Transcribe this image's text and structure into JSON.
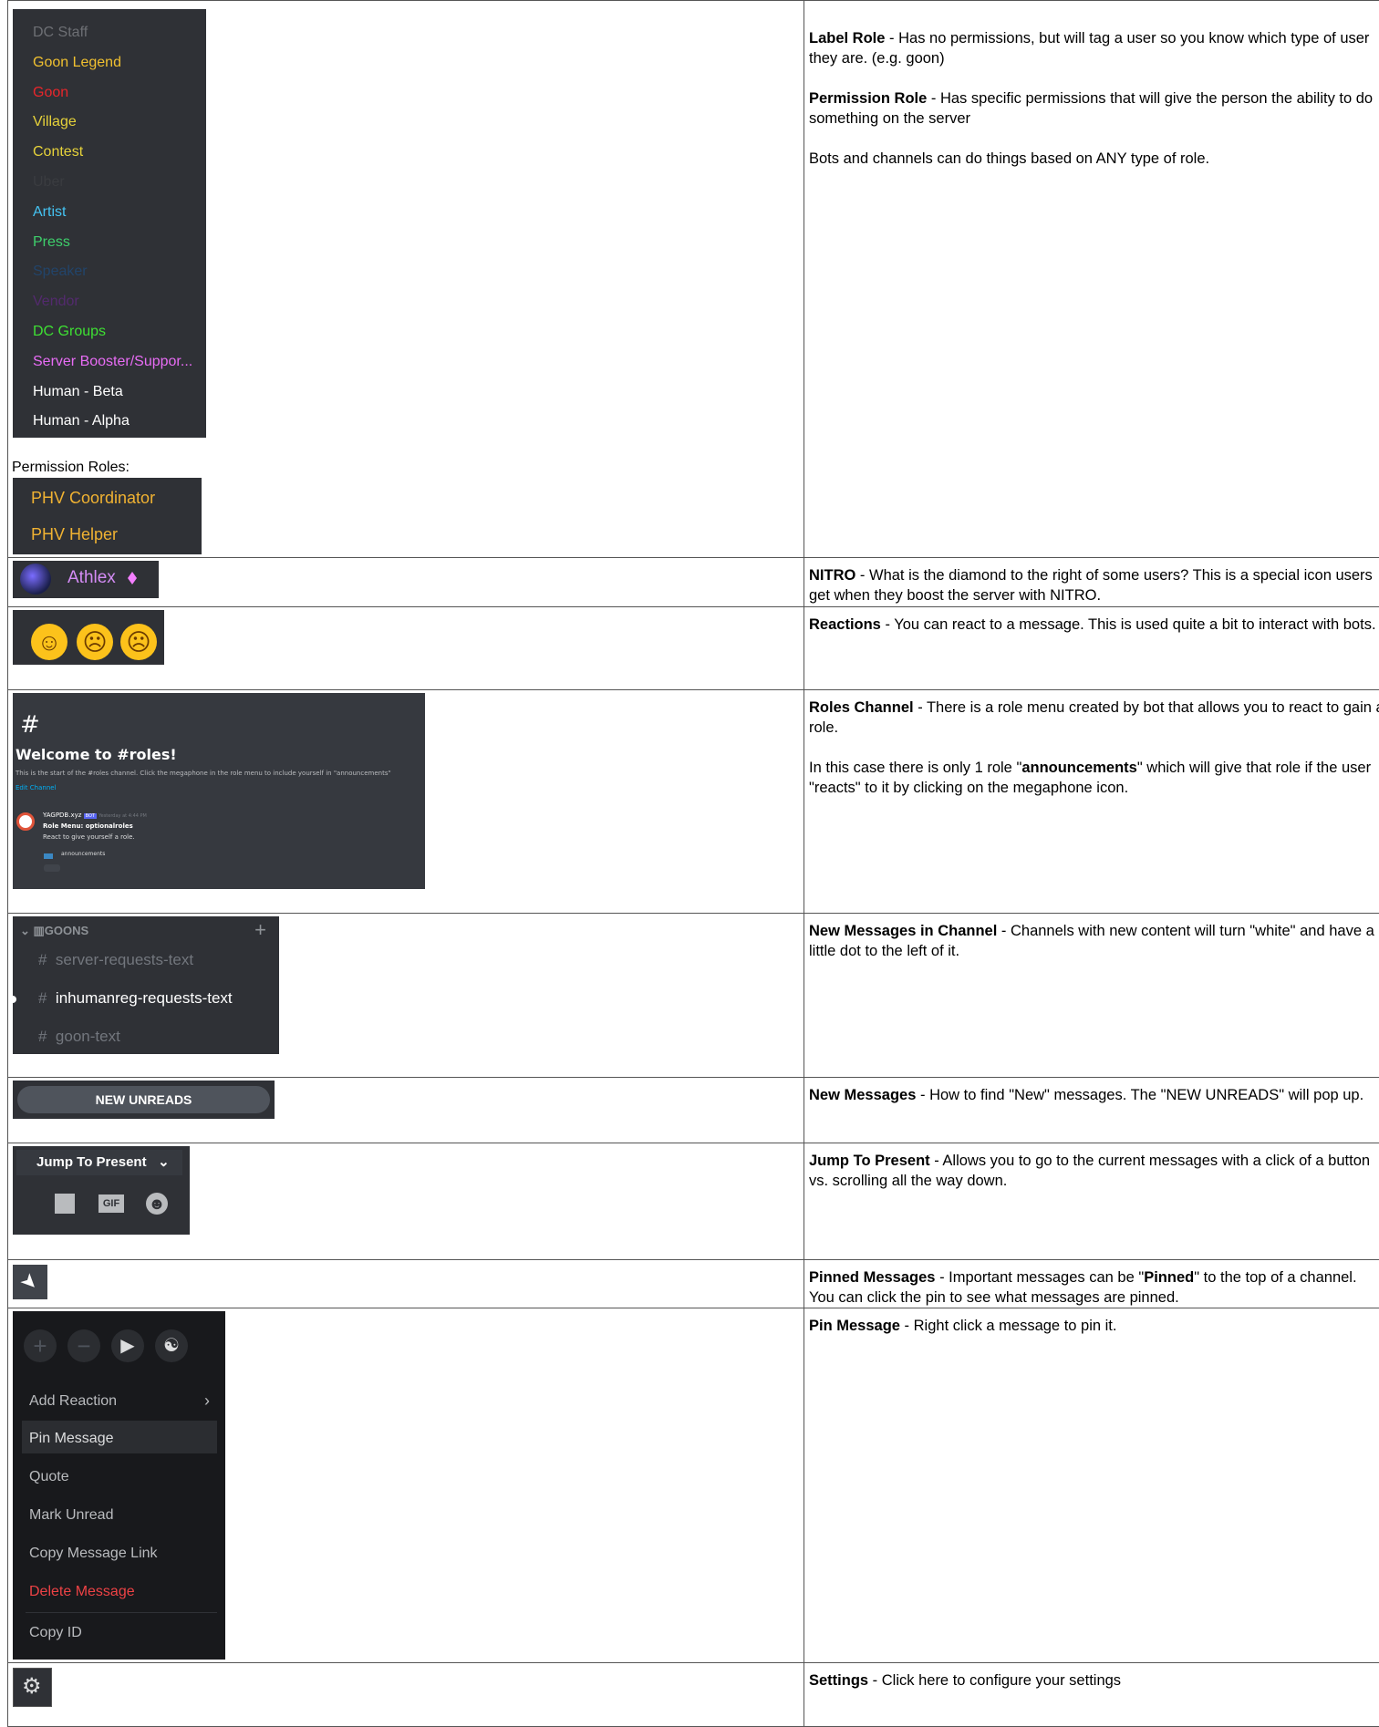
{
  "rows": [
    {
      "label_roles": [
        "DC Staff",
        "Goon Legend",
        "Goon",
        "Village",
        "Contest",
        "Uber",
        "Artist",
        "Press",
        "Speaker",
        "Vendor",
        "DC Groups",
        "Server Booster/Suppor...",
        "Human - Beta",
        "Human - Alpha"
      ],
      "label_role_colors": [
        "#6d6f74",
        "#f0c030",
        "#e8262b",
        "#e6d23a",
        "#e6d23a",
        "#3a3c40",
        "#44c3f2",
        "#3ecf6b",
        "#22446a",
        "#532a6e",
        "#3ee033",
        "#e86cf5",
        "#ffffff",
        "#ffffff"
      ],
      "perm_label": "Permission Roles:",
      "perm_roles": [
        "PHV Coordinator",
        "PHV Helper"
      ],
      "desc": [
        {
          "b": "Label Role",
          "t": " - Has no permissions, but will tag a user so you know which type of user they are.  (e.g. goon)"
        },
        {
          "b": "Permission Role",
          "t": " - Has specific permissions that will give the person the ability to do something on the server"
        },
        {
          "b": "",
          "t": "Bots and channels can do things based on ANY type of role."
        }
      ]
    },
    {
      "user": "Athlex",
      "desc": {
        "b": "NITRO",
        "t": " - What is the diamond to the right of some users?  This is a special icon users get when they boost the server with NITRO."
      }
    },
    {
      "desc": {
        "b": "Reactions",
        "t": " - You can react to a message.  This is used quite a bit to interact with bots."
      }
    },
    {
      "welcome": "Welcome to #roles!",
      "start_text": "This is the start of the #roles channel. Click the megaphone in the role menu to include yourself in \"announcements\"",
      "edit": "Edit Channel",
      "bot_name": "YAGPDB.xyz",
      "bot_tag": "BOT",
      "bot_time": "Yesterday at 4:44 PM",
      "menu_title": "Role Menu: optionalroles",
      "menu_sub": "React to give yourself a role.",
      "role_option": "announcements",
      "desc1": {
        "b": "Roles Channel",
        "t": "  - There is a role menu created by bot that allows you to react to gain a role."
      },
      "desc2_a": "In this case there is only 1 role \"",
      "desc2_b": "announcements",
      "desc2_c": "\" which will give that role if the user \"reacts\" to it by clicking on the megaphone icon."
    },
    {
      "category": "GOONS",
      "channels": [
        "server-requests-text",
        "inhumanreg-requests-text",
        "goon-text"
      ],
      "desc": {
        "b": "New Messages in Channel",
        "t": " - Channels with new content will turn \"white\" and have a little dot to the left of it."
      }
    },
    {
      "badge": "NEW UNREADS",
      "desc": {
        "b": "New Messages",
        "t": " - How to find \"New\" messages.  The \"NEW UNREADS\" will pop up."
      }
    },
    {
      "jump": "Jump To Present",
      "gif": "GIF",
      "desc": {
        "b": "Jump To Present",
        "t": " - Allows you to go to the current messages with a click of a button vs. scrolling all the way down."
      }
    },
    {
      "desc_a": "Important messages can be \"",
      "desc_b": "Pinned",
      "desc_c": "\" to the top of a channel.  You can click the pin to see what messages are pinned.",
      "title": "Pinned Messages"
    },
    {
      "menu": [
        "Add Reaction",
        "Pin Message",
        "Quote",
        "Mark Unread",
        "Copy Message Link",
        "Delete Message",
        "Copy ID"
      ],
      "desc": {
        "b": "Pin Message",
        "t": " - Right click a message to pin it."
      }
    },
    {
      "desc": {
        "b": "Settings",
        "t": " - Click here to configure your settings"
      }
    }
  ]
}
